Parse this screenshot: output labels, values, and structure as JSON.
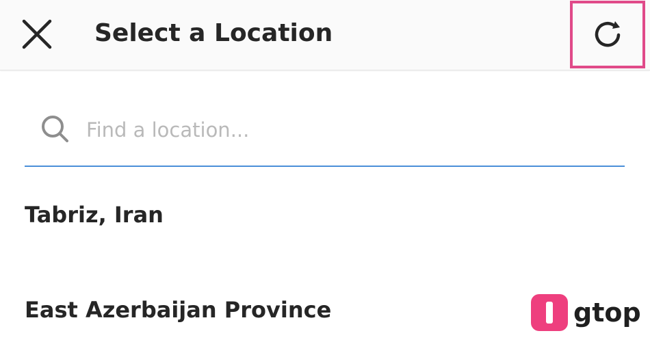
{
  "header": {
    "title": "Select a Location",
    "close_icon": "close-icon",
    "refresh_icon": "refresh-icon",
    "highlight_color": "#e04a89"
  },
  "search": {
    "placeholder": "Find a location...",
    "value": "",
    "icon": "search-icon",
    "underline_color": "#4a8fd8"
  },
  "results": [
    {
      "label": "Tabriz, Iran"
    },
    {
      "label": "East Azerbaijan Province"
    }
  ],
  "watermark": {
    "text": "gtop",
    "accent_color": "#ee3f7e"
  }
}
